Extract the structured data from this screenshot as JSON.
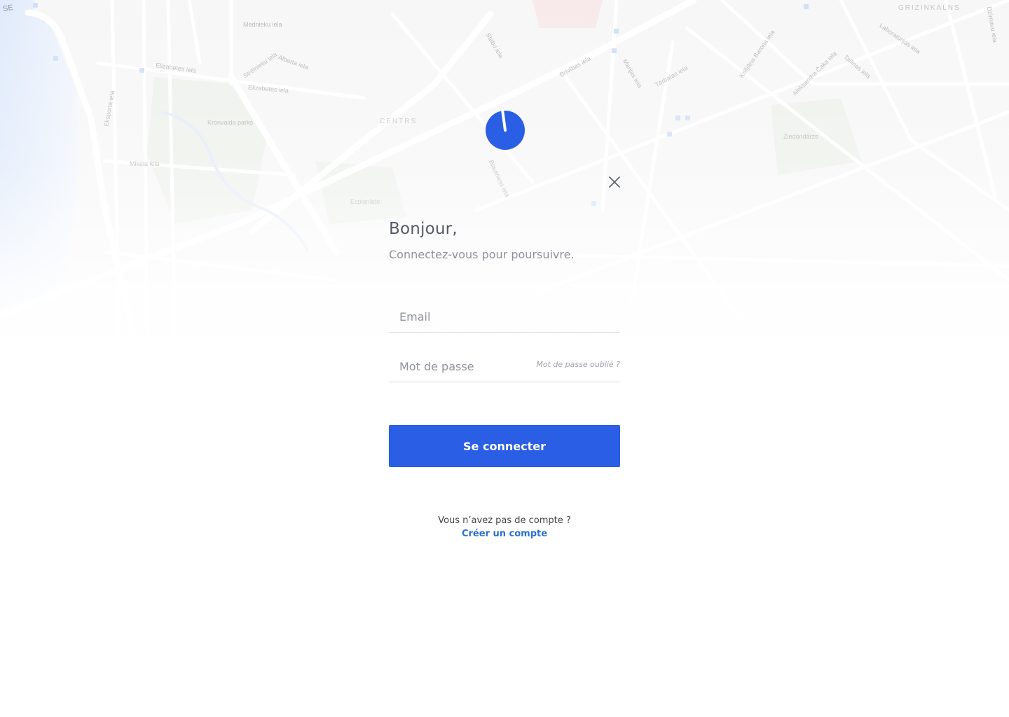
{
  "map": {
    "labels": [
      "Mednieku iela",
      "Elizabetes iela",
      "Alberta iela",
      "Strēlnieku iela",
      "Elizabetes iela",
      "Kronvalda parks",
      "Mikela iela",
      "Eksporta iela",
      "CENTRS",
      "Esplanāde",
      "Stabu iela",
      "Brīvības iela",
      "Tērbatas iela",
      "Ziedondārzs",
      "GRIZINKALNS",
      "Aleksandra Čaka iela",
      "Laboratorijas iela",
      "Tallinas iela",
      "Krišjāņa Barona iela",
      "Blaumaņa iela",
      "Marijas iela",
      "Dzirnavu iela"
    ],
    "region_label": "SE"
  },
  "logo": {
    "name": "logo-icon",
    "color": "#2a5ee5"
  },
  "close": {
    "icon": "close-icon"
  },
  "login": {
    "greeting": "Bonjour,",
    "subtitle": "Connectez-vous pour poursuivre.",
    "email_placeholder": "Email",
    "email_value": "",
    "password_placeholder": "Mot de passe",
    "password_value": "",
    "forgot_label": "Mot de passe oublié ?",
    "submit_label": "Se connecter",
    "no_account_text": "Vous n’avez pas de compte ?",
    "create_account_label": "Créer un compte"
  },
  "colors": {
    "accent": "#2a5ee5",
    "link": "#2a6fd6"
  }
}
